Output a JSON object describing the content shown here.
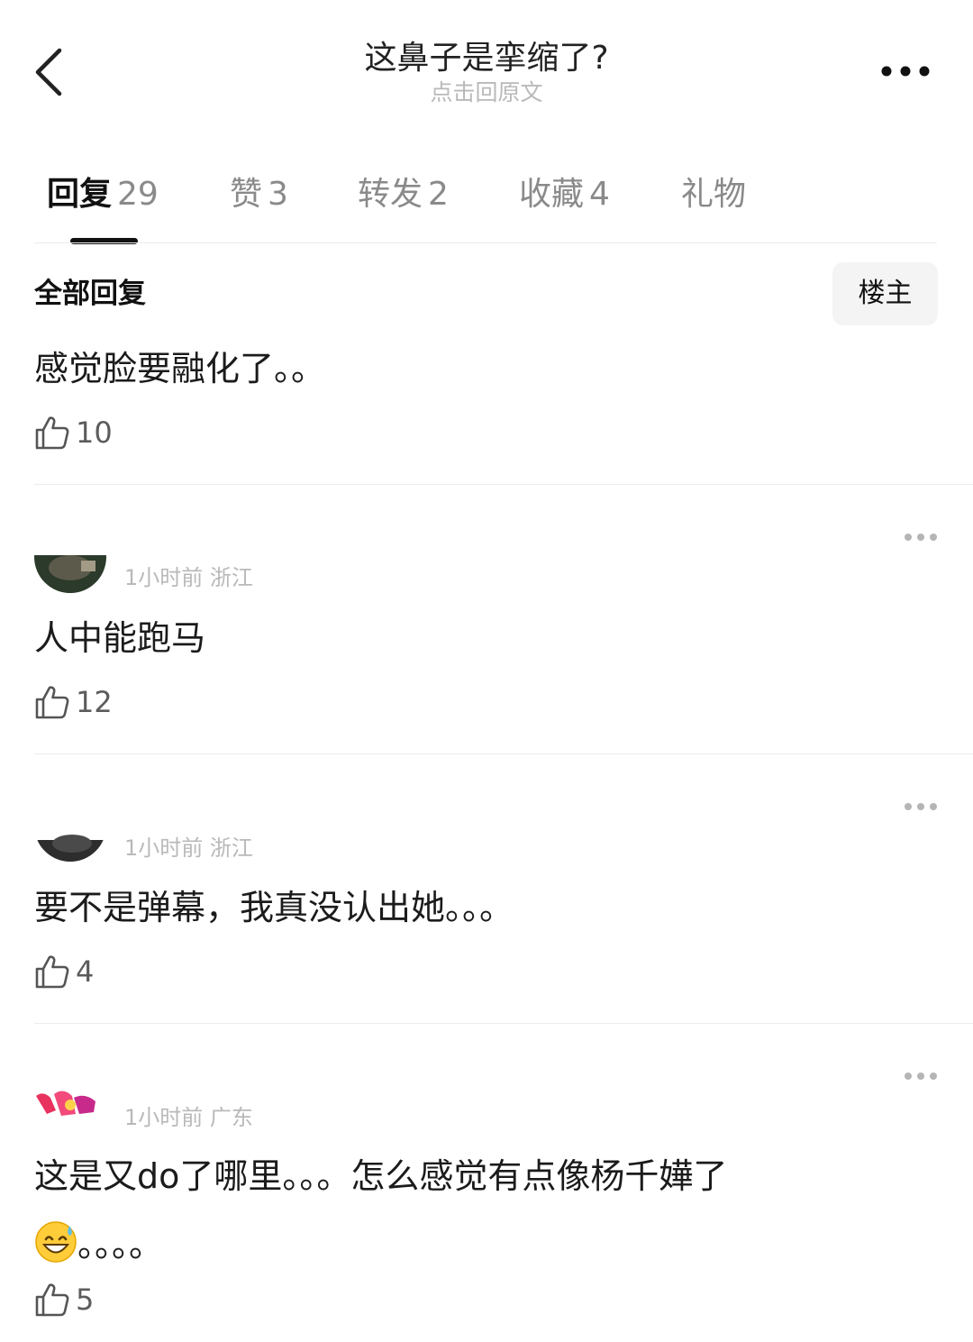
{
  "header": {
    "title": "这鼻子是挛缩了?",
    "subtitle": "点击回原文"
  },
  "tabs": [
    {
      "label": "回复",
      "count": "29"
    },
    {
      "label": "赞",
      "count": "3"
    },
    {
      "label": "转发",
      "count": "2"
    },
    {
      "label": "收藏",
      "count": "4"
    },
    {
      "label": "礼物",
      "count": ""
    }
  ],
  "filter": {
    "label": "全部回复",
    "op_button": "楼主"
  },
  "comments": [
    {
      "meta": "",
      "text": "感觉脸要融化了。。",
      "likes": "10"
    },
    {
      "meta": "1小时前 浙江",
      "text": "人中能跑马",
      "likes": "12"
    },
    {
      "meta": "1小时前 浙江",
      "text": "要不是弹幕，我真没认出她。。。",
      "likes": "4"
    },
    {
      "meta": "1小时前 广东",
      "text": "这是又do了哪里。。。怎么感觉有点像杨千嬅了",
      "text_cont": "。。。。",
      "likes": "5"
    }
  ],
  "icons": {
    "back": "chevron-left-icon",
    "more": "more-horizontal-icon",
    "like": "thumbs-up-icon",
    "emoji": "grinning-sweat-emoji"
  }
}
